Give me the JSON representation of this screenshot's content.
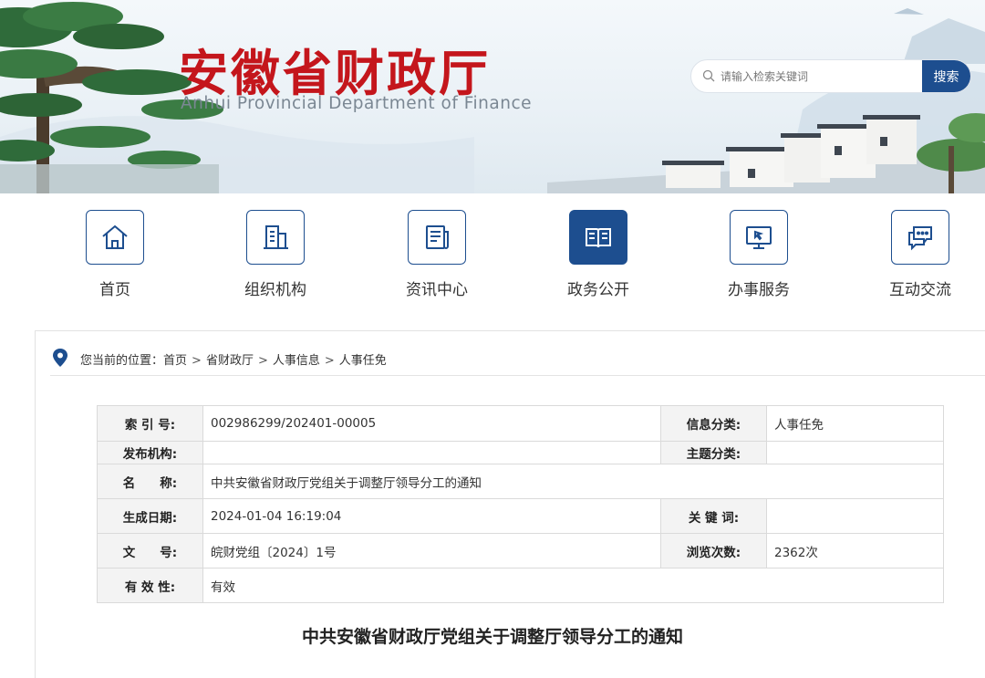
{
  "header": {
    "site_title": "安徽省财政厅",
    "site_subtitle": "Anhui Provincial Department of Finance",
    "search": {
      "placeholder": "请输入检索关键词",
      "button_label": "搜索"
    }
  },
  "nav": {
    "items": [
      {
        "label": "首页",
        "icon": "home-icon",
        "active": false
      },
      {
        "label": "组织机构",
        "icon": "building-icon",
        "active": false
      },
      {
        "label": "资讯中心",
        "icon": "news-icon",
        "active": false
      },
      {
        "label": "政务公开",
        "icon": "open-book-icon",
        "active": true
      },
      {
        "label": "办事服务",
        "icon": "monitor-icon",
        "active": false
      },
      {
        "label": "互动交流",
        "icon": "chat-bubbles-icon",
        "active": false
      }
    ]
  },
  "breadcrumb": {
    "prefix": "您当前的位置：",
    "items": [
      "首页",
      "省财政厅",
      "人事信息",
      "人事任免"
    ],
    "separator": ">"
  },
  "meta": {
    "index_label": "索 引 号:",
    "index_value": "002986299/202401-00005",
    "category_label": "信息分类:",
    "category_value": "人事任免",
    "publisher_label": "发布机构:",
    "publisher_value": "",
    "topic_label": "主题分类:",
    "topic_value": "",
    "name_label": "名　　称:",
    "name_value": "中共安徽省财政厅党组关于调整厅领导分工的通知",
    "date_label": "生成日期:",
    "date_value": "2024-01-04 16:19:04",
    "keyword_label": "关 键 词:",
    "keyword_value": "",
    "docno_label": "文　　号:",
    "docno_value": "皖财党组〔2024〕1号",
    "views_label": "浏览次数:",
    "views_value": "2362次",
    "validity_label": "有 效 性:",
    "validity_value": "有效"
  },
  "document": {
    "title": "中共安徽省财政厅党组关于调整厅领导分工的通知"
  },
  "colors": {
    "brand_red": "#c4161c",
    "brand_blue": "#1d4e8f"
  }
}
